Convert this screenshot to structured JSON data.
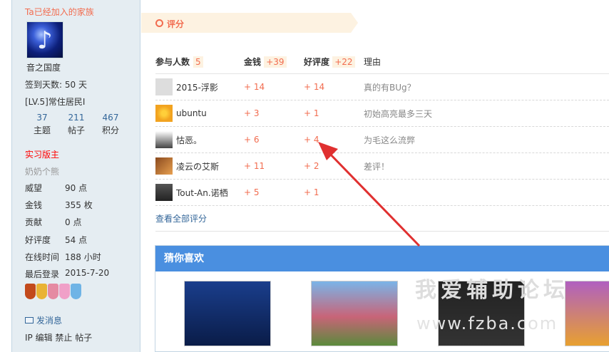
{
  "sidebar": {
    "family_title": "Ta已经加入的家族",
    "username": "音之国度",
    "checkin": "签到天数: 50 天",
    "level": "[LV.5]常住居民I",
    "stats": [
      {
        "num": "37",
        "label": "主题"
      },
      {
        "num": "211",
        "label": "帖子"
      },
      {
        "num": "467",
        "label": "积分"
      }
    ],
    "role": "实习版主",
    "role_sub": "奶奶个熊",
    "kv": [
      {
        "k": "威望",
        "v": "90 点"
      },
      {
        "k": "金钱",
        "v": "355 枚"
      },
      {
        "k": "贡献",
        "v": "0 点"
      },
      {
        "k": "好评度",
        "v": "54 点"
      },
      {
        "k": "在线时间",
        "v": "188 小时"
      },
      {
        "k": "最后登录",
        "v": "2015-7-20"
      }
    ],
    "send_msg": "发消息",
    "ops": "IP 编辑 禁止 帖子"
  },
  "rating": {
    "title": "评分",
    "h_users": "参与人数",
    "h_users_n": "5",
    "h_money": "金钱",
    "h_money_n": "+39",
    "h_good": "好评度",
    "h_good_n": "+22",
    "h_reason": "理由",
    "rows": [
      {
        "user": "2015-浮影",
        "money": "+ 14",
        "good": "+ 14",
        "reason": "真的有BUg？",
        "av": "#ddd"
      },
      {
        "user": "ubuntu",
        "money": "+ 3",
        "good": "+ 1",
        "reason": "初始高亮最多三天",
        "av": "#f2a320"
      },
      {
        "user": "怙恶。",
        "money": "+ 6",
        "good": "+ 4",
        "reason": "为毛这么流弊",
        "av": "#444"
      },
      {
        "user": "凌云の艾斯",
        "money": "+ 11",
        "good": "+ 2",
        "reason": "差评！",
        "av": "#c8641e"
      },
      {
        "user": "Tout-An.诺栖",
        "money": "+ 5",
        "good": "+ 1",
        "reason": "",
        "av": "#333"
      }
    ],
    "view_all": "查看全部评分"
  },
  "guess": {
    "title": "猜你喜欢"
  },
  "watermark": "我爱辅助论坛",
  "watermark_url": "www.fzba.com"
}
